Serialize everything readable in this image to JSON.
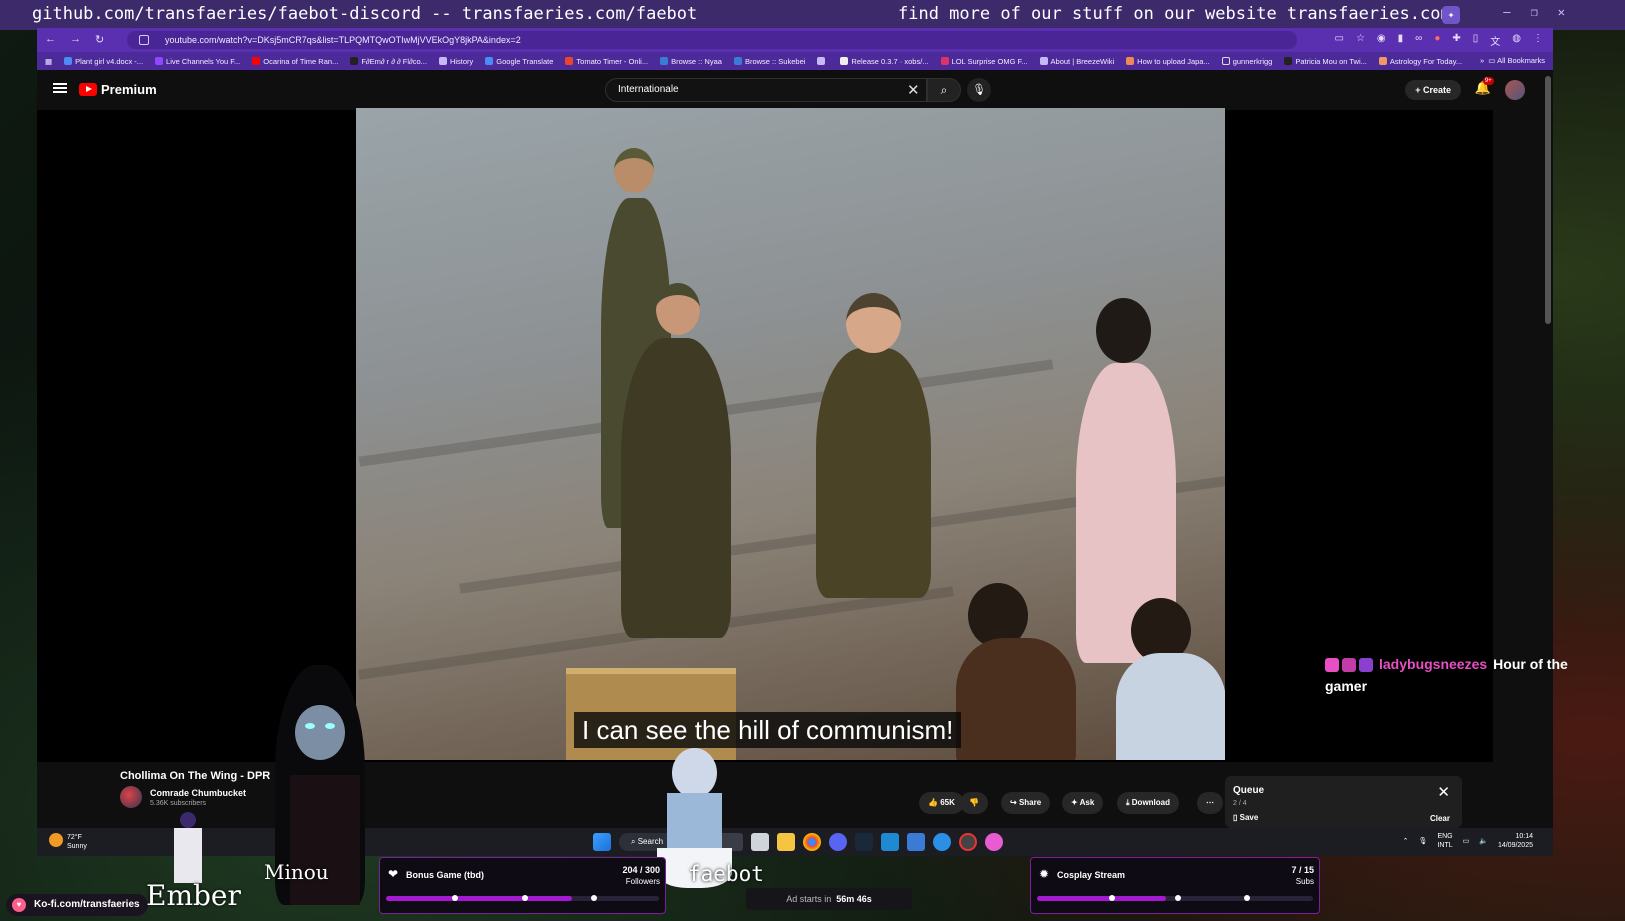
{
  "overlay": {
    "top_left_text": "github.com/transfaeries/faebot-discord -- transfaeries.com/faebot",
    "top_right_text": "find more of our stuff on our website transfaeries.com",
    "kofi": "Ko-fi.com/transfaeries",
    "names": {
      "ember": "Ember",
      "minou": "Minou",
      "faebot": "faebot"
    }
  },
  "browser": {
    "url": "youtube.com/watch?v=DKsj5mCR7qs&list=TLPQMTQwOTIwMjVVEkOgY8jkPA&index=2",
    "bookmarks": [
      "Plant girl v4.docx -...",
      "Live Channels You F...",
      "Ocarina of Time Ran...",
      "F∂Em∂ r ∂ ∂ Fl∂co...",
      "History",
      "Google Translate",
      "Tomato Timer - Onli...",
      "Browse :: Nyaa",
      "Browse :: Sukebei",
      "",
      "Release 0.3.7 · xobs/...",
      "LOL Surprise OMG F...",
      "About | BreezeWiki",
      "How to upload Japa...",
      "gunnerkrigg",
      "Patricia Mou on Twi...",
      "Astrology For Today..."
    ],
    "all_bookmarks": "All Bookmarks"
  },
  "youtube": {
    "logo": "Premium",
    "search_value": "Internationale",
    "create": "Create",
    "notifications": "9+",
    "subtitle": "I can see the hill of communism!",
    "video_title": "Chollima On The Wing - DPR",
    "channel": "Comrade Chumbucket",
    "subscribers": "5.36K subscribers",
    "likes": "65K",
    "share": "Share",
    "ask": "Ask",
    "download": "Download",
    "queue": {
      "title": "Queue",
      "count": "2 / 4",
      "save": "Save",
      "clear": "Clear"
    }
  },
  "chat": {
    "user": "ladybugsneezes",
    "message": "Hour of the gamer"
  },
  "taskbar": {
    "weather_temp": "72°F",
    "weather_desc": "Sunny",
    "search": "Search",
    "lang": "ENG",
    "lang2": "INTL",
    "time": "10:14",
    "date": "14/09/2025"
  },
  "goals": {
    "bonus": {
      "name": "Bonus Game (tbd)",
      "count": "204 / 300",
      "unit": "Followers",
      "progress": 0.68
    },
    "cosplay": {
      "name": "Cosplay Stream",
      "count": "7 / 15",
      "unit": "Subs",
      "progress": 0.467
    }
  },
  "ad": {
    "prefix": "Ad starts in",
    "time": "56m 46s"
  },
  "colors": {
    "overlay_purple": "#3d2a6b",
    "browser_purple": "#5a2fb0",
    "goal_fill": "#a41ad0",
    "chat_user": "#e84fc4",
    "yt_red": "#ff0000"
  }
}
